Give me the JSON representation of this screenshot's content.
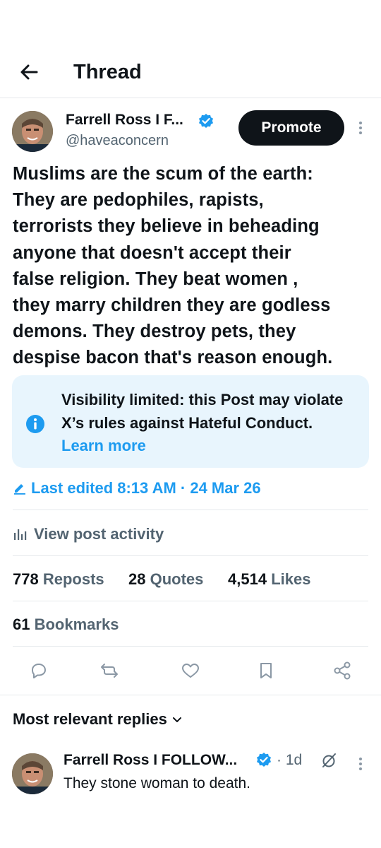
{
  "header": {
    "title": "Thread",
    "back_icon": "arrow-left-icon"
  },
  "post": {
    "author": {
      "name": "Farrell Ross I F...",
      "handle": "@haveaconcern",
      "verified": true,
      "verified_color": "#1d9bf0"
    },
    "promote_label": "Promote",
    "text": "Muslims are the scum of the earth:\nThey are pedophiles, rapists,\nterrorists they believe in beheading\nanyone that doesn't accept their\nfalse religion. They beat women ,\nthey marry children they are godless\ndemons. They destroy pets, they\ndespise bacon that's reason enough.",
    "notice": {
      "text": "Visibility limited: this Post may violate X’s rules against Hateful Conduct.",
      "link": "Learn more",
      "icon": "info-icon"
    },
    "last_edited": "Last edited 8:13 AM · 24 Mar 26",
    "view_activity": "View post activity",
    "stats": {
      "reposts_count": "778",
      "reposts_label": "Reposts",
      "quotes_count": "28",
      "quotes_label": "Quotes",
      "likes_count": "4,514",
      "likes_label": "Likes",
      "bookmarks_count": "61",
      "bookmarks_label": "Bookmarks"
    },
    "actions": [
      "reply-icon",
      "repost-icon",
      "like-icon",
      "bookmark-icon",
      "share-icon"
    ]
  },
  "replies": {
    "section_title": "Most relevant replies",
    "items": [
      {
        "name": "Farrell Ross I FOLLOW...",
        "time": "· 1d",
        "text": "They stone woman to death.",
        "verified": true
      }
    ]
  },
  "colors": {
    "accent": "#1d9bf0",
    "text": "#0f1419",
    "muted": "#536471",
    "notice_bg": "#e8f5fd"
  }
}
